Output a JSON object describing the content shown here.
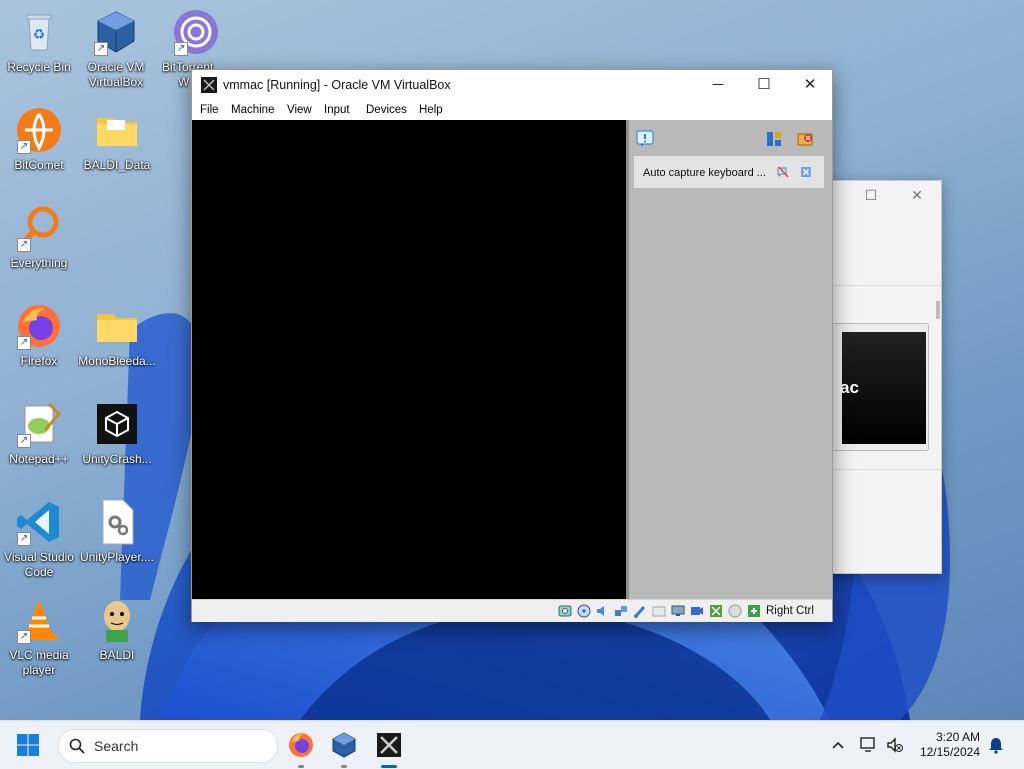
{
  "desktop": {
    "icons": [
      {
        "label": "Recycle Bin",
        "icon": "recycle-bin-icon"
      },
      {
        "label": "Oracle VM VirtualBox",
        "icon": "virtualbox-icon"
      },
      {
        "label": "BitTorrent Web",
        "icon": "bittorrent-icon"
      },
      {
        "label": "BitComet",
        "icon": "bitcomet-icon"
      },
      {
        "label": "BALDI_Data",
        "icon": "folder-icon"
      },
      {
        "label": "Everything",
        "icon": "search-magnifier-icon"
      },
      {
        "label": "Firefox",
        "icon": "firefox-icon"
      },
      {
        "label": "MonoBleeda...",
        "icon": "folder-icon"
      },
      {
        "label": "Notepad++",
        "icon": "notepadpp-icon"
      },
      {
        "label": "UnityCrash...",
        "icon": "unity-icon"
      },
      {
        "label": "Visual Studio Code",
        "icon": "vscode-icon"
      },
      {
        "label": "UnityPlayer....",
        "icon": "settings-file-icon"
      },
      {
        "label": "VLC media player",
        "icon": "vlc-icon"
      },
      {
        "label": "BALDI",
        "icon": "baldi-icon"
      }
    ],
    "bittorrent_label_line1": "BitTorrent",
    "bittorrent_label_line2": "W"
  },
  "back_window": {
    "preview_text": "ac"
  },
  "vbox_window": {
    "title": "vmmac [Running] - Oracle VM VirtualBox",
    "controls": {
      "minimize": "─",
      "maximize": "☐",
      "close": "✕"
    },
    "menu": [
      "File",
      "Machine",
      "View",
      "Input",
      "Devices",
      "Help"
    ],
    "notification": {
      "text": "Auto capture keyboard ..."
    },
    "statusbar": {
      "host_key": "Right Ctrl"
    }
  },
  "taskbar": {
    "search_placeholder": "Search",
    "time": "3:20 AM",
    "date": "12/15/2024"
  },
  "colors": {
    "accent": "#0067c0",
    "vm_screen": "#000000",
    "side_panel": "#b9b9b9"
  }
}
